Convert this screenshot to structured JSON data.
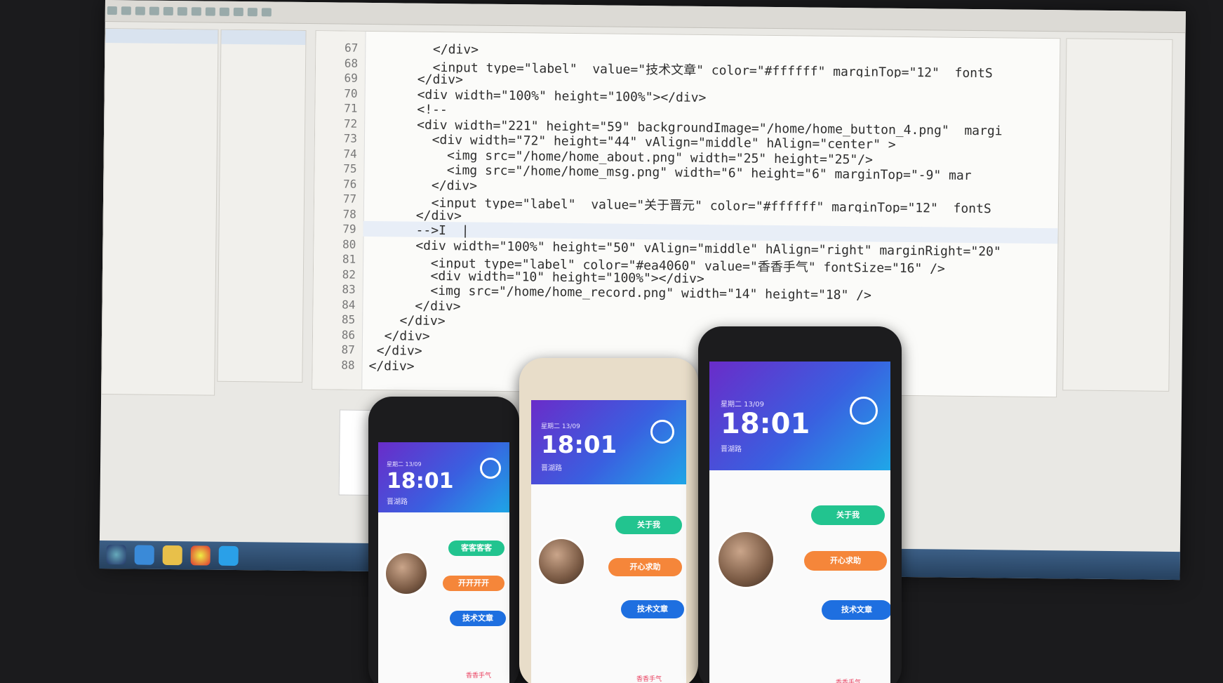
{
  "code": {
    "lines": [
      {
        "n": "67",
        "text": "        </div>"
      },
      {
        "n": "68",
        "text": "        <input type=\"label\"  value=\"技术文章\" color=\"#ffffff\" marginTop=\"12\"  fontS"
      },
      {
        "n": "69",
        "text": "      </div>"
      },
      {
        "n": "70",
        "text": "      <div width=\"100%\" height=\"100%\"></div>"
      },
      {
        "n": "71",
        "text": "      <!--"
      },
      {
        "n": "72",
        "text": "      <div width=\"221\" height=\"59\" backgroundImage=\"/home/home_button_4.png\"  margi"
      },
      {
        "n": "73",
        "text": "        <div width=\"72\" height=\"44\" vAlign=\"middle\" hAlign=\"center\" >"
      },
      {
        "n": "74",
        "text": "          <img src=\"/home/home_about.png\" width=\"25\" height=\"25\"/>"
      },
      {
        "n": "75",
        "text": "          <img src=\"/home/home_msg.png\" width=\"6\" height=\"6\" marginTop=\"-9\" mar"
      },
      {
        "n": "76",
        "text": "        </div>"
      },
      {
        "n": "77",
        "text": "        <input type=\"label\"  value=\"关于晋元\" color=\"#ffffff\" marginTop=\"12\"  fontS"
      },
      {
        "n": "78",
        "text": "      </div>"
      },
      {
        "n": "79",
        "text": "      -->I  |"
      },
      {
        "n": "80",
        "text": "      <div width=\"100%\" height=\"50\" vAlign=\"middle\" hAlign=\"right\" marginRight=\"20\""
      },
      {
        "n": "81",
        "text": "        <input type=\"label\" color=\"#ea4060\" value=\"香香手气\" fontSize=\"16\" />"
      },
      {
        "n": "82",
        "text": "        <div width=\"10\" height=\"100%\"></div>"
      },
      {
        "n": "83",
        "text": "        <img src=\"/home/home_record.png\" width=\"14\" height=\"18\" />"
      },
      {
        "n": "84",
        "text": "      </div>"
      },
      {
        "n": "85",
        "text": "    </div>"
      },
      {
        "n": "86",
        "text": "  </div>"
      },
      {
        "n": "87",
        "text": " </div>"
      },
      {
        "n": "88",
        "text": "</div>"
      }
    ]
  },
  "phones": {
    "small": {
      "time": "18:01",
      "date": "星期二  13/09",
      "location": "晋湖路",
      "pills": [
        "客客客客",
        "开开开开",
        "技术文章"
      ],
      "bottom": "香香手气"
    },
    "middle": {
      "time": "18:01",
      "date": "星期二  13/09",
      "location": "晋湖路",
      "pills": [
        "关于我",
        "开心求助",
        "技术文章"
      ],
      "bottom": "香香手气"
    },
    "large": {
      "time": "18:01",
      "date": "星期二  13/09",
      "location": "晋湖路",
      "pills": [
        "关于我",
        "开心求助",
        "技术文章"
      ],
      "bottom": "香香手气"
    }
  },
  "colors": {
    "accent": "#ea4060",
    "hero_start": "#6a2cc9",
    "hero_end": "#1fa7e8",
    "green": "#22c48f",
    "orange": "#f5863a",
    "blue": "#1e6fe0"
  }
}
